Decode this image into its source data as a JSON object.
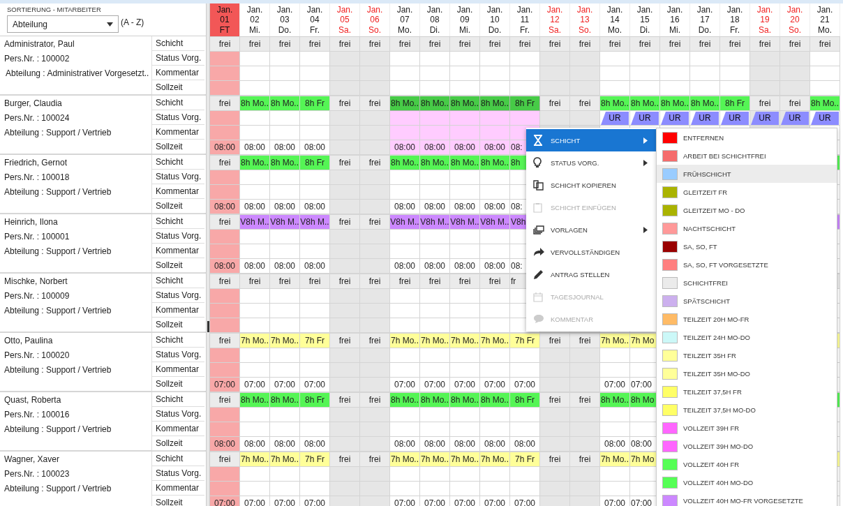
{
  "sort_panel": {
    "label": "SORTIERUNG - MITARBEITER",
    "dropdown_value": "Abteilung",
    "order": "(A - Z)"
  },
  "days": [
    {
      "month": "Jan.",
      "day": "01",
      "weekday": "FT",
      "kind": "holiday"
    },
    {
      "month": "Jan.",
      "day": "02",
      "weekday": "Mi.",
      "kind": "workday"
    },
    {
      "month": "Jan.",
      "day": "03",
      "weekday": "Do.",
      "kind": "workday"
    },
    {
      "month": "Jan.",
      "day": "04",
      "weekday": "Fr.",
      "kind": "workday"
    },
    {
      "month": "Jan.",
      "day": "05",
      "weekday": "Sa.",
      "kind": "weekend"
    },
    {
      "month": "Jan.",
      "day": "06",
      "weekday": "So.",
      "kind": "weekend"
    },
    {
      "month": "Jan.",
      "day": "07",
      "weekday": "Mo.",
      "kind": "workday"
    },
    {
      "month": "Jan.",
      "day": "08",
      "weekday": "Di.",
      "kind": "workday"
    },
    {
      "month": "Jan.",
      "day": "09",
      "weekday": "Mi.",
      "kind": "workday"
    },
    {
      "month": "Jan.",
      "day": "10",
      "weekday": "Do.",
      "kind": "workday"
    },
    {
      "month": "Jan.",
      "day": "11",
      "weekday": "Fr.",
      "kind": "workday"
    },
    {
      "month": "Jan.",
      "day": "12",
      "weekday": "Sa.",
      "kind": "weekend"
    },
    {
      "month": "Jan.",
      "day": "13",
      "weekday": "So.",
      "kind": "weekend"
    },
    {
      "month": "Jan.",
      "day": "14",
      "weekday": "Mo.",
      "kind": "workday"
    },
    {
      "month": "Jan.",
      "day": "15",
      "weekday": "Di.",
      "kind": "workday"
    },
    {
      "month": "Jan.",
      "day": "16",
      "weekday": "Mi.",
      "kind": "workday"
    },
    {
      "month": "Jan.",
      "day": "17",
      "weekday": "Do.",
      "kind": "workday"
    },
    {
      "month": "Jan.",
      "day": "18",
      "weekday": "Fr.",
      "kind": "workday"
    },
    {
      "month": "Jan.",
      "day": "19",
      "weekday": "Sa.",
      "kind": "weekend"
    },
    {
      "month": "Jan.",
      "day": "20",
      "weekday": "So.",
      "kind": "weekend"
    },
    {
      "month": "Jan.",
      "day": "21",
      "weekday": "Mo.",
      "kind": "workday"
    }
  ],
  "employees": [
    {
      "name": "Administrator, Paul",
      "pers_nr": "Pers.Nr. : 100002",
      "department": "Abteilung : Administrativer Vorgesetzt..",
      "row_labels": [
        "Schicht",
        "Status Vorg.",
        "Kommentar",
        "Sollzeit"
      ],
      "color": "#ebebeb",
      "days": [
        {
          "shift": "frei",
          "selected": false
        },
        {
          "shift": "frei",
          "selected": false
        },
        {
          "shift": "frei",
          "selected": false
        },
        {
          "shift": "frei",
          "selected": false
        },
        {
          "shift": "frei",
          "selected": false
        },
        {
          "shift": "frei",
          "selected": false
        },
        {
          "shift": "frei",
          "selected": false
        },
        {
          "shift": "frei",
          "selected": false
        },
        {
          "shift": "frei",
          "selected": false
        },
        {
          "shift": "frei",
          "selected": false
        },
        {
          "shift": "frei",
          "selected": false
        },
        {
          "shift": "frei",
          "selected": false
        },
        {
          "shift": "frei",
          "selected": false
        },
        {
          "shift": "frei",
          "selected": false
        },
        {
          "shift": "frei",
          "selected": false
        },
        {
          "shift": "frei",
          "selected": false
        },
        {
          "shift": "frei",
          "selected": false
        },
        {
          "shift": "frei",
          "selected": false
        },
        {
          "shift": "frei",
          "selected": false
        },
        {
          "shift": "frei",
          "selected": false
        },
        {
          "shift": "frei",
          "selected": false
        }
      ]
    },
    {
      "name": "Burger, Claudia",
      "pers_nr": "Pers.Nr. : 100024",
      "department": "Abteilung : Support / Vertrieb",
      "row_labels": [
        "Schicht",
        "Status Vorg.",
        "Kommentar",
        "Sollzeit"
      ],
      "color": "#55f555",
      "days": [
        {
          "shift": "frei",
          "sollzeit": "08:00",
          "selected": false
        },
        {
          "shift": "8h Mo..",
          "sollzeit": "08:00",
          "selected": false
        },
        {
          "shift": "8h Mo..",
          "sollzeit": "08:00",
          "selected": false
        },
        {
          "shift": "8h Fr",
          "sollzeit": "08:00",
          "selected": false
        },
        {
          "shift": "frei",
          "selected": false
        },
        {
          "shift": "frei",
          "selected": false
        },
        {
          "shift": "8h Mo..",
          "sollzeit": "08:00",
          "selected": true
        },
        {
          "shift": "8h Mo..",
          "sollzeit": "08:00",
          "selected": true
        },
        {
          "shift": "8h Mo..",
          "sollzeit": "08:00",
          "selected": true
        },
        {
          "shift": "8h Mo..",
          "sollzeit": "08:00",
          "selected": true
        },
        {
          "shift": "8h Fr",
          "sollzeit": "08:",
          "selected": true
        },
        {
          "shift": "frei",
          "selected": false
        },
        {
          "shift": "frei",
          "selected": false
        },
        {
          "shift": "8h Mo..",
          "status": "UR",
          "selected": false
        },
        {
          "shift": "8h Mo..",
          "status": "UR",
          "selected": false
        },
        {
          "shift": "8h Mo..",
          "status": "UR",
          "selected": false
        },
        {
          "shift": "8h Mo..",
          "status": "UR",
          "selected": false
        },
        {
          "shift": "8h Fr",
          "status": "UR",
          "selected": false
        },
        {
          "shift": "frei",
          "status": "UR",
          "selected": false
        },
        {
          "shift": "frei",
          "status": "UR",
          "selected": false
        },
        {
          "shift": "8h Mo..",
          "status": "UR",
          "selected": false
        }
      ]
    },
    {
      "name": "Friedrich, Gernot",
      "pers_nr": "Pers.Nr. : 100018",
      "department": "Abteilung : Support / Vertrieb",
      "row_labels": [
        "Schicht",
        "Status Vorg.",
        "Kommentar",
        "Sollzeit"
      ],
      "color": "#55f555",
      "days": [
        {
          "shift": "frei",
          "sollzeit": "08:00",
          "selected": false
        },
        {
          "shift": "8h Mo..",
          "sollzeit": "08:00",
          "selected": false
        },
        {
          "shift": "8h Mo..",
          "sollzeit": "08:00",
          "selected": false
        },
        {
          "shift": "8h Fr",
          "sollzeit": "08:00",
          "selected": false
        },
        {
          "shift": "frei",
          "selected": false
        },
        {
          "shift": "frei",
          "selected": false
        },
        {
          "shift": "8h Mo..",
          "sollzeit": "08:00",
          "selected": false
        },
        {
          "shift": "8h Mo..",
          "sollzeit": "08:00",
          "selected": false
        },
        {
          "shift": "8h Mo..",
          "sollzeit": "08:00",
          "selected": false
        },
        {
          "shift": "8h Mo..",
          "sollzeit": "08:00",
          "selected": false
        },
        {
          "shift": "8h",
          "sollzeit": "08:",
          "selected": false
        }
      ]
    },
    {
      "name": "Heinrich, Ilona",
      "pers_nr": "Pers.Nr. : 100001",
      "department": "Abteilung : Support / Vertrieb",
      "row_labels": [
        "Schicht",
        "Status Vorg.",
        "Kommentar",
        "Sollzeit"
      ],
      "color": "#cc88ff",
      "days": [
        {
          "shift": "frei",
          "sollzeit": "08:00",
          "selected": false
        },
        {
          "shift": "V8h M..",
          "sollzeit": "08:00",
          "selected": false
        },
        {
          "shift": "V8h M..",
          "sollzeit": "08:00",
          "selected": false
        },
        {
          "shift": "V8h M..",
          "sollzeit": "08:00",
          "selected": false
        },
        {
          "shift": "frei",
          "selected": false
        },
        {
          "shift": "frei",
          "selected": false
        },
        {
          "shift": "V8h M..",
          "sollzeit": "08:00",
          "selected": false
        },
        {
          "shift": "V8h M..",
          "sollzeit": "08:00",
          "selected": false
        },
        {
          "shift": "V8h M..",
          "sollzeit": "08:00",
          "selected": false
        },
        {
          "shift": "V8h M..",
          "sollzeit": "08:00",
          "selected": false
        },
        {
          "shift": "V8h",
          "sollzeit": "08:",
          "selected": false
        }
      ]
    },
    {
      "name": "Mischke, Norbert",
      "pers_nr": "Pers.Nr. : 100009",
      "department": "Abteilung : Support / Vertrieb",
      "row_labels": [
        "Schicht",
        "Status Vorg.",
        "Kommentar",
        "Sollzeit"
      ],
      "color": "#ebebeb",
      "days": [
        {
          "shift": "frei",
          "selected": false
        },
        {
          "shift": "frei",
          "selected": false
        },
        {
          "shift": "frei",
          "selected": false
        },
        {
          "shift": "frei",
          "selected": false
        },
        {
          "shift": "frei",
          "selected": false
        },
        {
          "shift": "frei",
          "selected": false
        },
        {
          "shift": "frei",
          "selected": false
        },
        {
          "shift": "frei",
          "selected": false
        },
        {
          "shift": "frei",
          "selected": false
        },
        {
          "shift": "frei",
          "selected": false
        },
        {
          "shift": "fr",
          "selected": false
        }
      ]
    },
    {
      "name": "Otto, Paulina",
      "pers_nr": "Pers.Nr. : 100020",
      "department": "Abteilung : Support / Vertrieb",
      "row_labels": [
        "Schicht",
        "Status Vorg.",
        "Kommentar",
        "Sollzeit"
      ],
      "color": "#ffff99",
      "days": [
        {
          "shift": "frei",
          "sollzeit": "07:00",
          "selected": false
        },
        {
          "shift": "7h Mo..",
          "sollzeit": "07:00",
          "selected": false
        },
        {
          "shift": "7h Mo..",
          "sollzeit": "07:00",
          "selected": false
        },
        {
          "shift": "7h Fr",
          "sollzeit": "07:00",
          "selected": false
        },
        {
          "shift": "frei",
          "selected": false
        },
        {
          "shift": "frei",
          "selected": false
        },
        {
          "shift": "7h Mo..",
          "sollzeit": "07:00",
          "selected": false
        },
        {
          "shift": "7h Mo..",
          "sollzeit": "07:00",
          "selected": false
        },
        {
          "shift": "7h Mo..",
          "sollzeit": "07:00",
          "selected": false
        },
        {
          "shift": "7h Mo..",
          "sollzeit": "07:00",
          "selected": false
        },
        {
          "shift": "7h Fr",
          "sollzeit": "07:00",
          "selected": false
        },
        {
          "shift": "frei",
          "selected": false
        },
        {
          "shift": "frei",
          "selected": false
        },
        {
          "shift": "7h Mo..",
          "sollzeit": "07:00",
          "selected": false
        },
        {
          "shift": "7h Mo",
          "sollzeit": "07:00",
          "selected": false
        }
      ]
    },
    {
      "name": "Quast, Roberta",
      "pers_nr": "Pers.Nr. : 100016",
      "department": "Abteilung : Support / Vertrieb",
      "row_labels": [
        "Schicht",
        "Status Vorg.",
        "Kommentar",
        "Sollzeit"
      ],
      "color": "#55f555",
      "days": [
        {
          "shift": "frei",
          "sollzeit": "08:00",
          "selected": false
        },
        {
          "shift": "8h Mo..",
          "sollzeit": "08:00",
          "selected": false
        },
        {
          "shift": "8h Mo..",
          "sollzeit": "08:00",
          "selected": false
        },
        {
          "shift": "8h Fr",
          "sollzeit": "08:00",
          "selected": false
        },
        {
          "shift": "frei",
          "selected": false
        },
        {
          "shift": "frei",
          "selected": false
        },
        {
          "shift": "8h Mo..",
          "sollzeit": "08:00",
          "selected": false
        },
        {
          "shift": "8h Mo..",
          "sollzeit": "08:00",
          "selected": false
        },
        {
          "shift": "8h Mo..",
          "sollzeit": "08:00",
          "selected": false
        },
        {
          "shift": "8h Mo..",
          "sollzeit": "08:00",
          "selected": false
        },
        {
          "shift": "8h Fr",
          "sollzeit": "08:00",
          "selected": false
        },
        {
          "shift": "frei",
          "selected": false
        },
        {
          "shift": "frei",
          "selected": false
        },
        {
          "shift": "8h Mo..",
          "sollzeit": "08:00",
          "selected": false
        },
        {
          "shift": "8h Mo",
          "sollzeit": "08:00",
          "selected": false
        }
      ]
    },
    {
      "name": "Wagner, Xaver",
      "pers_nr": "Pers.Nr. : 100023",
      "department": "Abteilung : Support / Vertrieb",
      "row_labels": [
        "Schicht",
        "Status Vorg.",
        "Kommentar",
        "Sollzeit"
      ],
      "color": "#ffff99",
      "days": [
        {
          "shift": "frei",
          "sollzeit": "07:00",
          "selected": false
        },
        {
          "shift": "7h Mo..",
          "sollzeit": "07:00",
          "selected": false
        },
        {
          "shift": "7h Mo..",
          "sollzeit": "07:00",
          "selected": false
        },
        {
          "shift": "7h Fr",
          "sollzeit": "07:00",
          "selected": false
        },
        {
          "shift": "frei",
          "selected": false
        },
        {
          "shift": "frei",
          "selected": false
        },
        {
          "shift": "7h Mo..",
          "sollzeit": "07:00",
          "selected": false
        },
        {
          "shift": "7h Mo..",
          "sollzeit": "07:00",
          "selected": false
        },
        {
          "shift": "7h Mo..",
          "sollzeit": "07:00",
          "selected": false
        },
        {
          "shift": "7h Mo..",
          "sollzeit": "07:00",
          "selected": false
        },
        {
          "shift": "7h Fr",
          "sollzeit": "07:00",
          "selected": false
        },
        {
          "shift": "frei",
          "selected": false
        },
        {
          "shift": "frei",
          "selected": false
        },
        {
          "shift": "7h Mo..",
          "sollzeit": "07:00",
          "selected": false
        },
        {
          "shift": "7h Mo",
          "sollzeit": "07:00",
          "selected": false
        }
      ]
    }
  ],
  "context_menu": [
    {
      "label": "SCHICHT",
      "submenu": true,
      "disabled": false,
      "selected": true
    },
    {
      "label": "STATUS VORG.",
      "submenu": true,
      "disabled": false,
      "selected": false
    },
    {
      "label": "SCHICHT KOPIEREN",
      "submenu": false,
      "disabled": false,
      "selected": false
    },
    {
      "label": "SCHICHT EINFÜGEN",
      "submenu": false,
      "disabled": true,
      "selected": false
    },
    {
      "label": "VORLAGEN",
      "submenu": true,
      "disabled": false,
      "selected": false
    },
    {
      "label": "VERVOLLSTÄNDIGEN",
      "submenu": false,
      "disabled": false,
      "selected": false
    },
    {
      "label": "ANTRAG STELLEN",
      "submenu": false,
      "disabled": false,
      "selected": false
    },
    {
      "label": "TAGESJOURNAL",
      "submenu": false,
      "disabled": true,
      "selected": false
    },
    {
      "label": "KOMMENTAR",
      "submenu": false,
      "disabled": true,
      "selected": false
    }
  ],
  "shift_submenu": [
    {
      "label": "ENTFERNEN",
      "color": "#ff0000",
      "selected": false
    },
    {
      "label": "ARBEIT BEI SCHICHTFREI",
      "color": "#f56c6c",
      "selected": false
    },
    {
      "label": "FRÜHSCHICHT",
      "color": "#99ccff",
      "selected": true
    },
    {
      "label": "GLEITZEIT FR",
      "color": "#aab300",
      "selected": false
    },
    {
      "label": "GLEITZEIT MO - DO",
      "color": "#aab300",
      "selected": false
    },
    {
      "label": "NACHTSCHICHT",
      "color": "#ff9999",
      "selected": false
    },
    {
      "label": "SA, SO, FT",
      "color": "#990000",
      "selected": false
    },
    {
      "label": "SA, SO, FT VORGESETZTE",
      "color": "#ff7f7f",
      "selected": false
    },
    {
      "label": "SCHICHTFREI",
      "color": "#ebebeb",
      "selected": false
    },
    {
      "label": "SPÄTSCHICHT",
      "color": "#ccb0ee",
      "selected": false
    },
    {
      "label": "TEILZEIT 20H MO-FR",
      "color": "#ffbb66",
      "selected": false
    },
    {
      "label": "TEILZEIT 24H MO-DO",
      "color": "#ccf8f8",
      "selected": false
    },
    {
      "label": "TEILZEIT 35H FR",
      "color": "#ffff99",
      "selected": false
    },
    {
      "label": "TEILZEIT 35H MO-DO",
      "color": "#ffff99",
      "selected": false
    },
    {
      "label": "TEILZEIT 37,5H FR",
      "color": "#ffff66",
      "selected": false
    },
    {
      "label": "TEILZEIT 37,5H MO-DO",
      "color": "#ffff66",
      "selected": false
    },
    {
      "label": "VOLLZEIT 39H FR",
      "color": "#ff66ff",
      "selected": false
    },
    {
      "label": "VOLLZEIT 39H MO-DO",
      "color": "#ff66ff",
      "selected": false
    },
    {
      "label": "VOLLZEIT 40H FR",
      "color": "#55ff55",
      "selected": false
    },
    {
      "label": "VOLLZEIT 40H MO-DO",
      "color": "#55ff55",
      "selected": false
    },
    {
      "label": "VOLLZEIT 40H MO-FR VORGESETZTE",
      "color": "#cc88ff",
      "selected": false
    }
  ]
}
